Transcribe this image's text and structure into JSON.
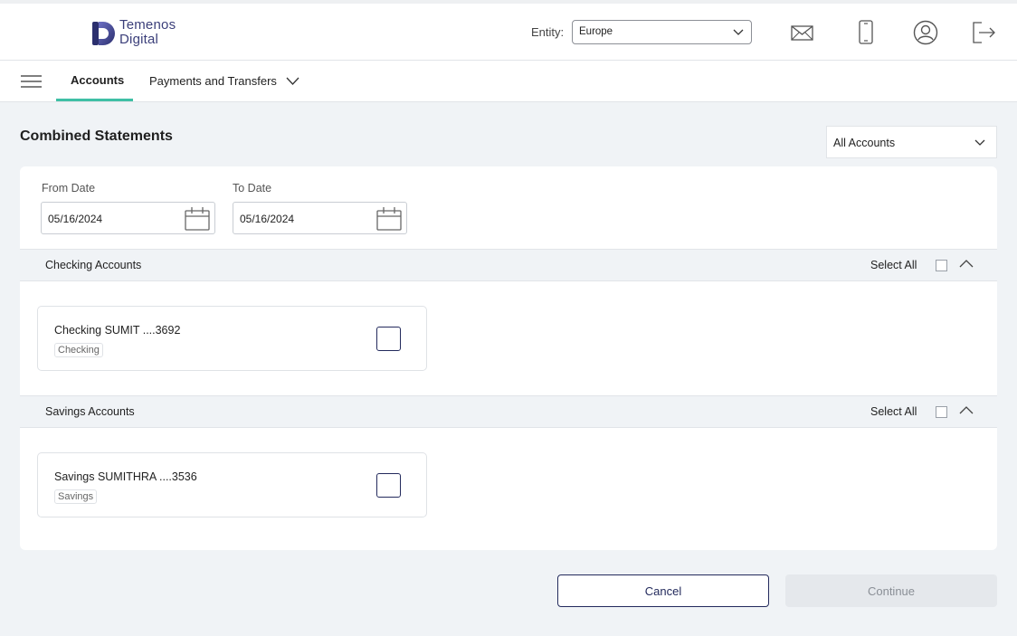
{
  "brand": {
    "line1": "Temenos",
    "line2": "Digital"
  },
  "header": {
    "entity_label": "Entity:",
    "entity_value": "Europe",
    "icons": [
      "mail-icon",
      "mobile-icon",
      "profile-icon",
      "logout-icon"
    ]
  },
  "nav": {
    "tabs": [
      {
        "label": "Accounts",
        "active": true
      },
      {
        "label": "Payments and Transfers",
        "active": false
      }
    ]
  },
  "page": {
    "title": "Combined Statements",
    "account_filter": "All Accounts"
  },
  "dates": {
    "from_label": "From Date",
    "from_value": "05/16/2024",
    "to_label": "To Date",
    "to_value": "05/16/2024"
  },
  "sections": [
    {
      "title": "Checking Accounts",
      "select_all": "Select All",
      "accounts": [
        {
          "name": "Checking SUMIT ....3692",
          "type": "Checking",
          "checked": false
        }
      ]
    },
    {
      "title": "Savings Accounts",
      "select_all": "Select All",
      "accounts": [
        {
          "name": "Savings SUMITHRA ....3536",
          "type": "Savings",
          "checked": false
        }
      ]
    }
  ],
  "actions": {
    "cancel": "Cancel",
    "continue": "Continue"
  },
  "colors": {
    "accent": "#3fbfa5",
    "brand": "#232a5c",
    "background": "#f0f3f6"
  }
}
